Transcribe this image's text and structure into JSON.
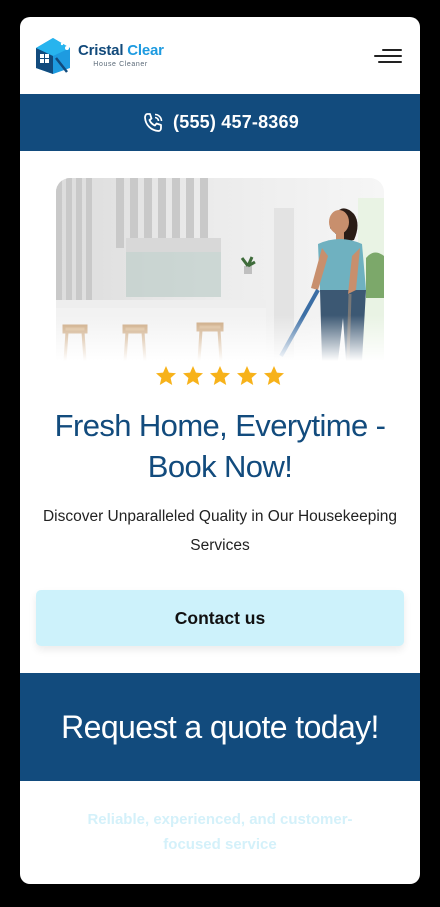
{
  "brand": {
    "name_part1": "Cristal",
    "name_part2": "Clear",
    "tagline": "House Cleaner"
  },
  "header": {
    "menu_icon": "hamburger-menu-icon"
  },
  "phone_bar": {
    "icon": "phone-ringing-icon",
    "number": "(555) 457-8369"
  },
  "hero": {
    "image_alt": "woman vacuuming a bright white kitchen",
    "rating_stars": 5,
    "star_icon": "star-icon",
    "headline_line1": "Fresh Home, Everytime -",
    "headline_line2": "Book Now!",
    "subtext_line1": "Discover Unparalleled Quality in Our Housekeeping",
    "subtext_line2": "Services",
    "cta_label": "Contact us"
  },
  "quote": {
    "title": "Request a quote today!",
    "subtitle_line1": "Reliable, experienced, and customer-",
    "subtitle_line2": "focused service"
  },
  "colors": {
    "primary": "#124b7d",
    "accent": "#1e9be0",
    "cta_bg": "#cdf2fb",
    "star": "#f7b21a"
  }
}
